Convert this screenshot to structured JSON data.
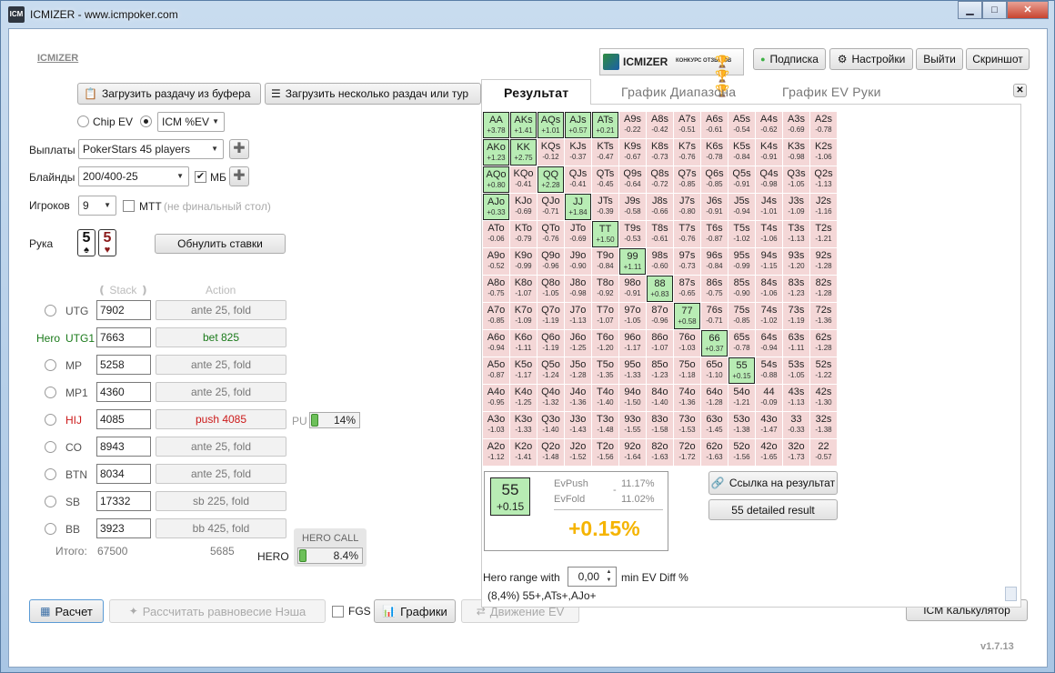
{
  "window": {
    "title": "ICMIZER - www.icmpoker.com",
    "app_icon": "ICM",
    "minimize": "▁",
    "maximize": "□",
    "close": "✕"
  },
  "header": {
    "link_title": "ICMIZER",
    "banner_main": "ICMIZER",
    "banner_sub": "КОНКУРС ОТЗЫВОВ",
    "subscribe": "Подписка",
    "settings": "Настройки",
    "logout": "Выйти",
    "screenshot": "Скриншот"
  },
  "load": {
    "from_buffer": "Загрузить раздачу из буфера",
    "several": "Загрузить несколько раздач или тур"
  },
  "model": {
    "chip_ev": "Chip EV",
    "icm_value": "ICM %EV"
  },
  "payouts": {
    "label": "Выплаты",
    "value": "PokerStars 45 players"
  },
  "blinds": {
    "label": "Блайнды",
    "value": "200/400-25",
    "mb_label": "МБ",
    "mb_checked": true
  },
  "players": {
    "label": "Игроков",
    "value": "9",
    "mtt_label": "МТТ",
    "mtt_note": "(не финальный стол)"
  },
  "hand": {
    "label": "Рука",
    "cards": [
      {
        "rank": "5",
        "suit": "♠",
        "color": "#111111"
      },
      {
        "rank": "5",
        "suit": "♥",
        "color": "#8b1a1a"
      }
    ],
    "reset_button": "Обнулить ставки"
  },
  "table_headers": {
    "stack": "Stack",
    "action": "Action"
  },
  "seats": [
    {
      "pos": "UTG",
      "stack": "7902",
      "action": "ante 25, fold",
      "hero": false,
      "color": "#555555",
      "action_color": "#777777"
    },
    {
      "pos": "UTG1",
      "stack": "7663",
      "action": "bet 825",
      "hero": true,
      "hero_label": "Hero",
      "color": "#1a7a1a",
      "action_color": "#1a7a1a"
    },
    {
      "pos": "MP",
      "stack": "5258",
      "action": "ante 25, fold",
      "hero": false,
      "color": "#555555",
      "action_color": "#777777"
    },
    {
      "pos": "MP1",
      "stack": "4360",
      "action": "ante 25, fold",
      "hero": false,
      "color": "#555555",
      "action_color": "#777777"
    },
    {
      "pos": "HIJ",
      "stack": "4085",
      "action": "push 4085",
      "hero": false,
      "color": "#cc1a1a",
      "action_color": "#cc1a1a"
    },
    {
      "pos": "CO",
      "stack": "8943",
      "action": "ante 25, fold",
      "hero": false,
      "color": "#555555",
      "action_color": "#777777"
    },
    {
      "pos": "BTN",
      "stack": "8034",
      "action": "ante 25, fold",
      "hero": false,
      "color": "#555555",
      "action_color": "#777777"
    },
    {
      "pos": "SB",
      "stack": "17332",
      "action": "sb 225, fold",
      "hero": false,
      "color": "#555555",
      "action_color": "#777777"
    },
    {
      "pos": "BB",
      "stack": "3923",
      "action": "bb 425, fold",
      "hero": false,
      "color": "#555555",
      "action_color": "#777777"
    }
  ],
  "pu": {
    "label": "PU",
    "value": "14%",
    "fraction": 0.14
  },
  "totals": {
    "label": "Итого:",
    "stack": "67500",
    "action": "5685"
  },
  "hero_call": {
    "title": "HERO CALL",
    "label": "HERO",
    "value": "8.4%",
    "fraction": 0.084
  },
  "bottom": {
    "calc": "Расчет",
    "nash": "Рассчитать равновесие Нэша",
    "fgs": "FGS",
    "charts": "Графики",
    "ev_move": "Движение EV",
    "icm_calc": "ICM Калькулятор",
    "version": "v1.7.13"
  },
  "tabs": {
    "result": "Результат",
    "range": "График Диапазона",
    "ev": "График EV Руки",
    "close": "✕"
  },
  "grid": [
    [
      [
        "AA",
        "+3.78",
        1
      ],
      [
        "AKs",
        "+1.41",
        1
      ],
      [
        "AQs",
        "+1.01",
        1
      ],
      [
        "AJs",
        "+0.57",
        1
      ],
      [
        "ATs",
        "+0.21",
        1
      ],
      [
        "A9s",
        "-0.22",
        0
      ],
      [
        "A8s",
        "-0.42",
        0
      ],
      [
        "A7s",
        "-0.51",
        0
      ],
      [
        "A6s",
        "-0.61",
        0
      ],
      [
        "A5s",
        "-0.54",
        0
      ],
      [
        "A4s",
        "-0.62",
        0
      ],
      [
        "A3s",
        "-0.69",
        0
      ],
      [
        "A2s",
        "-0.78",
        0
      ]
    ],
    [
      [
        "AKo",
        "+1.23",
        1
      ],
      [
        "KK",
        "+2.75",
        1
      ],
      [
        "KQs",
        "-0.12",
        0
      ],
      [
        "KJs",
        "-0.37",
        0
      ],
      [
        "KTs",
        "-0.47",
        0
      ],
      [
        "K9s",
        "-0.67",
        0
      ],
      [
        "K8s",
        "-0.73",
        0
      ],
      [
        "K7s",
        "-0.76",
        0
      ],
      [
        "K6s",
        "-0.78",
        0
      ],
      [
        "K5s",
        "-0.84",
        0
      ],
      [
        "K4s",
        "-0.91",
        0
      ],
      [
        "K3s",
        "-0.98",
        0
      ],
      [
        "K2s",
        "-1.06",
        0
      ]
    ],
    [
      [
        "AQo",
        "+0.80",
        1
      ],
      [
        "KQo",
        "-0.41",
        0
      ],
      [
        "QQ",
        "+2.28",
        1
      ],
      [
        "QJs",
        "-0.41",
        0
      ],
      [
        "QTs",
        "-0.45",
        0
      ],
      [
        "Q9s",
        "-0.64",
        0
      ],
      [
        "Q8s",
        "-0.72",
        0
      ],
      [
        "Q7s",
        "-0.85",
        0
      ],
      [
        "Q6s",
        "-0.85",
        0
      ],
      [
        "Q5s",
        "-0.91",
        0
      ],
      [
        "Q4s",
        "-0.98",
        0
      ],
      [
        "Q3s",
        "-1.05",
        0
      ],
      [
        "Q2s",
        "-1.13",
        0
      ]
    ],
    [
      [
        "AJo",
        "+0.33",
        1
      ],
      [
        "KJo",
        "-0.69",
        0
      ],
      [
        "QJo",
        "-0.71",
        0
      ],
      [
        "JJ",
        "+1.84",
        1
      ],
      [
        "JTs",
        "-0.39",
        0
      ],
      [
        "J9s",
        "-0.58",
        0
      ],
      [
        "J8s",
        "-0.66",
        0
      ],
      [
        "J7s",
        "-0.80",
        0
      ],
      [
        "J6s",
        "-0.91",
        0
      ],
      [
        "J5s",
        "-0.94",
        0
      ],
      [
        "J4s",
        "-1.01",
        0
      ],
      [
        "J3s",
        "-1.09",
        0
      ],
      [
        "J2s",
        "-1.16",
        0
      ]
    ],
    [
      [
        "ATo",
        "-0.06",
        0
      ],
      [
        "KTo",
        "-0.79",
        0
      ],
      [
        "QTo",
        "-0.76",
        0
      ],
      [
        "JTo",
        "-0.69",
        0
      ],
      [
        "TT",
        "+1.50",
        1
      ],
      [
        "T9s",
        "-0.53",
        0
      ],
      [
        "T8s",
        "-0.61",
        0
      ],
      [
        "T7s",
        "-0.76",
        0
      ],
      [
        "T6s",
        "-0.87",
        0
      ],
      [
        "T5s",
        "-1.02",
        0
      ],
      [
        "T4s",
        "-1.06",
        0
      ],
      [
        "T3s",
        "-1.13",
        0
      ],
      [
        "T2s",
        "-1.21",
        0
      ]
    ],
    [
      [
        "A9o",
        "-0.52",
        0
      ],
      [
        "K9o",
        "-0.99",
        0
      ],
      [
        "Q9o",
        "-0.96",
        0
      ],
      [
        "J9o",
        "-0.90",
        0
      ],
      [
        "T9o",
        "-0.84",
        0
      ],
      [
        "99",
        "+1.11",
        1
      ],
      [
        "98s",
        "-0.60",
        0
      ],
      [
        "97s",
        "-0.73",
        0
      ],
      [
        "96s",
        "-0.84",
        0
      ],
      [
        "95s",
        "-0.99",
        0
      ],
      [
        "94s",
        "-1.15",
        0
      ],
      [
        "93s",
        "-1.20",
        0
      ],
      [
        "92s",
        "-1.28",
        0
      ]
    ],
    [
      [
        "A8o",
        "-0.75",
        0
      ],
      [
        "K8o",
        "-1.07",
        0
      ],
      [
        "Q8o",
        "-1.05",
        0
      ],
      [
        "J8o",
        "-0.98",
        0
      ],
      [
        "T8o",
        "-0.92",
        0
      ],
      [
        "98o",
        "-0.91",
        0
      ],
      [
        "88",
        "+0.83",
        1
      ],
      [
        "87s",
        "-0.65",
        0
      ],
      [
        "86s",
        "-0.75",
        0
      ],
      [
        "85s",
        "-0.90",
        0
      ],
      [
        "84s",
        "-1.06",
        0
      ],
      [
        "83s",
        "-1.23",
        0
      ],
      [
        "82s",
        "-1.28",
        0
      ]
    ],
    [
      [
        "A7o",
        "-0.85",
        0
      ],
      [
        "K7o",
        "-1.09",
        0
      ],
      [
        "Q7o",
        "-1.19",
        0
      ],
      [
        "J7o",
        "-1.13",
        0
      ],
      [
        "T7o",
        "-1.07",
        0
      ],
      [
        "97o",
        "-1.05",
        0
      ],
      [
        "87o",
        "-0.96",
        0
      ],
      [
        "77",
        "+0.58",
        1
      ],
      [
        "76s",
        "-0.71",
        0
      ],
      [
        "75s",
        "-0.85",
        0
      ],
      [
        "74s",
        "-1.02",
        0
      ],
      [
        "73s",
        "-1.19",
        0
      ],
      [
        "72s",
        "-1.36",
        0
      ]
    ],
    [
      [
        "A6o",
        "-0.94",
        0
      ],
      [
        "K6o",
        "-1.11",
        0
      ],
      [
        "Q6o",
        "-1.19",
        0
      ],
      [
        "J6o",
        "-1.25",
        0
      ],
      [
        "T6o",
        "-1.20",
        0
      ],
      [
        "96o",
        "-1.17",
        0
      ],
      [
        "86o",
        "-1.07",
        0
      ],
      [
        "76o",
        "-1.03",
        0
      ],
      [
        "66",
        "+0.37",
        1
      ],
      [
        "65s",
        "-0.78",
        0
      ],
      [
        "64s",
        "-0.94",
        0
      ],
      [
        "63s",
        "-1.11",
        0
      ],
      [
        "62s",
        "-1.28",
        0
      ]
    ],
    [
      [
        "A5o",
        "-0.87",
        0
      ],
      [
        "K5o",
        "-1.17",
        0
      ],
      [
        "Q5o",
        "-1.24",
        0
      ],
      [
        "J5o",
        "-1.28",
        0
      ],
      [
        "T5o",
        "-1.35",
        0
      ],
      [
        "95o",
        "-1.33",
        0
      ],
      [
        "85o",
        "-1.23",
        0
      ],
      [
        "75o",
        "-1.18",
        0
      ],
      [
        "65o",
        "-1.10",
        0
      ],
      [
        "55",
        "+0.15",
        1
      ],
      [
        "54s",
        "-0.88",
        0
      ],
      [
        "53s",
        "-1.05",
        0
      ],
      [
        "52s",
        "-1.22",
        0
      ]
    ],
    [
      [
        "A4o",
        "-0.95",
        0
      ],
      [
        "K4o",
        "-1.25",
        0
      ],
      [
        "Q4o",
        "-1.32",
        0
      ],
      [
        "J4o",
        "-1.36",
        0
      ],
      [
        "T4o",
        "-1.40",
        0
      ],
      [
        "94o",
        "-1.50",
        0
      ],
      [
        "84o",
        "-1.40",
        0
      ],
      [
        "74o",
        "-1.36",
        0
      ],
      [
        "64o",
        "-1.28",
        0
      ],
      [
        "54o",
        "-1.21",
        0
      ],
      [
        "44",
        "-0.09",
        0
      ],
      [
        "43s",
        "-1.13",
        0
      ],
      [
        "42s",
        "-1.30",
        0
      ]
    ],
    [
      [
        "A3o",
        "-1.03",
        0
      ],
      [
        "K3o",
        "-1.33",
        0
      ],
      [
        "Q3o",
        "-1.40",
        0
      ],
      [
        "J3o",
        "-1.43",
        0
      ],
      [
        "T3o",
        "-1.48",
        0
      ],
      [
        "93o",
        "-1.55",
        0
      ],
      [
        "83o",
        "-1.58",
        0
      ],
      [
        "73o",
        "-1.53",
        0
      ],
      [
        "63o",
        "-1.45",
        0
      ],
      [
        "53o",
        "-1.38",
        0
      ],
      [
        "43o",
        "-1.47",
        0
      ],
      [
        "33",
        "-0.33",
        0
      ],
      [
        "32s",
        "-1.38",
        0
      ]
    ],
    [
      [
        "A2o",
        "-1.12",
        0
      ],
      [
        "K2o",
        "-1.41",
        0
      ],
      [
        "Q2o",
        "-1.48",
        0
      ],
      [
        "J2o",
        "-1.52",
        0
      ],
      [
        "T2o",
        "-1.56",
        0
      ],
      [
        "92o",
        "-1.64",
        0
      ],
      [
        "82o",
        "-1.63",
        0
      ],
      [
        "72o",
        "-1.72",
        0
      ],
      [
        "62o",
        "-1.63",
        0
      ],
      [
        "52o",
        "-1.56",
        0
      ],
      [
        "42o",
        "-1.65",
        0
      ],
      [
        "32o",
        "-1.73",
        0
      ],
      [
        "22",
        "-0.57",
        0
      ]
    ]
  ],
  "result": {
    "hand": "55",
    "hand_ev": "+0.15",
    "evpush_label": "EvPush",
    "evpush_value": "11.17%",
    "evfold_label": "EvFold",
    "evfold_value": "11.02%",
    "dash": "-",
    "diff": "+0.15%"
  },
  "links": {
    "result_link": "Ссылка на результат",
    "detailed": "55 detailed result"
  },
  "range": {
    "label": "Hero range with",
    "value": "0,00",
    "unit": "min EV Diff %",
    "summary": "(8,4%) 55+,ATs+,AJo+"
  },
  "colors": {
    "push": "#b8ecb4",
    "fold": "#f4d7d7",
    "accent": "#f5b400"
  }
}
